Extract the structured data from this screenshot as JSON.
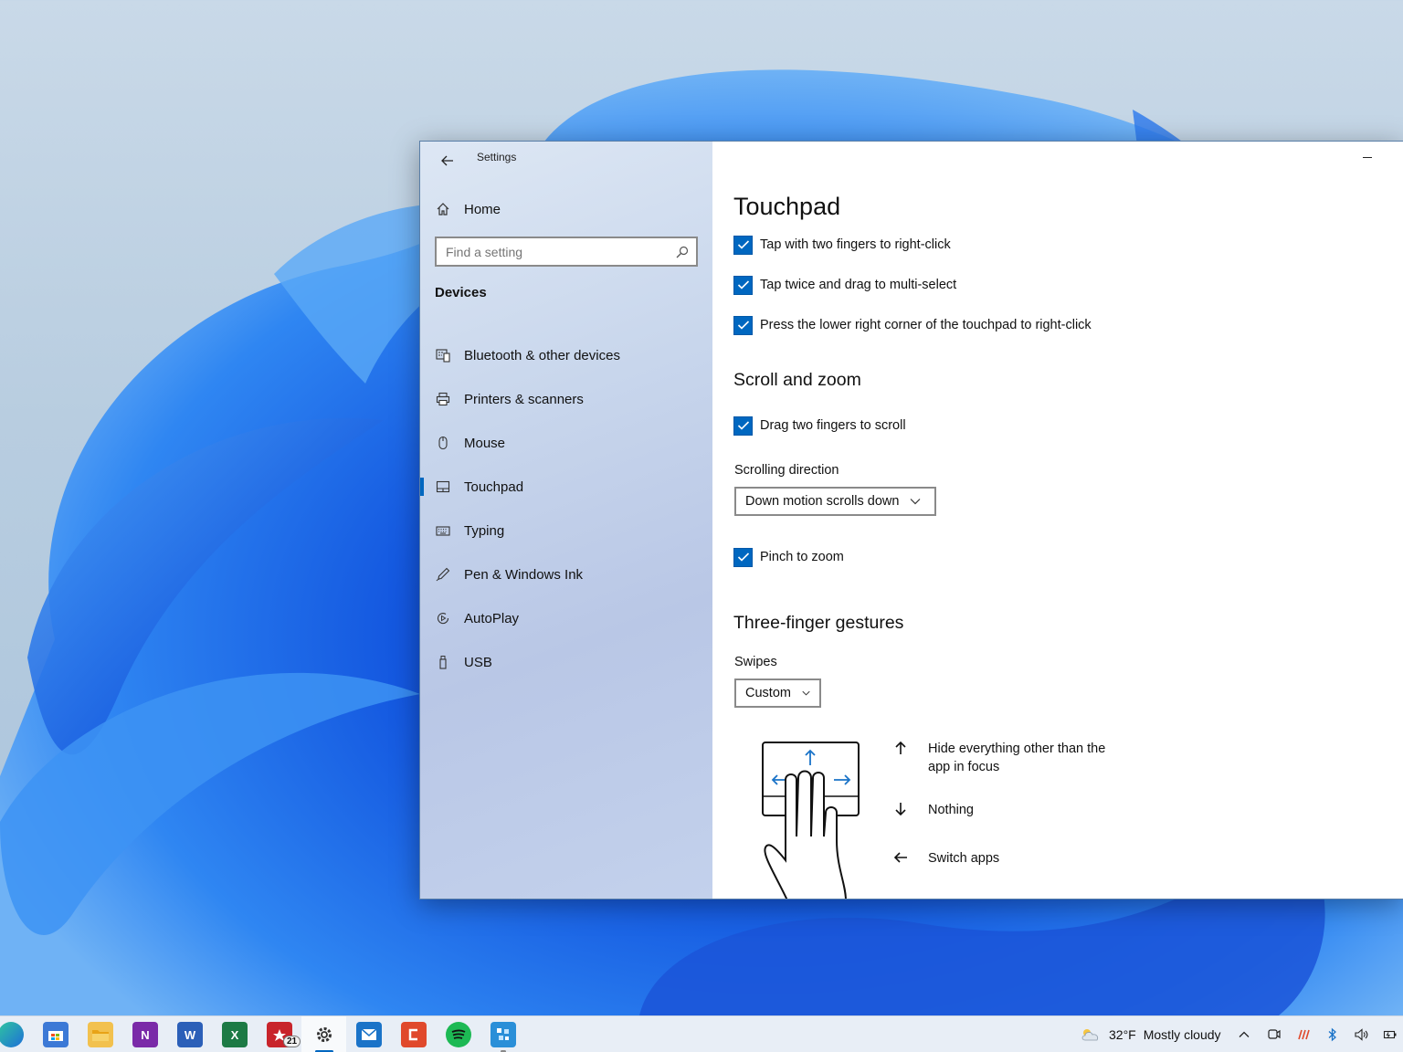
{
  "window": {
    "title": "Settings"
  },
  "nav": {
    "home_label": "Home",
    "search_placeholder": "Find a setting",
    "section_title": "Devices",
    "items": [
      {
        "label": "Bluetooth & other devices",
        "icon": "bluetooth-devices-icon",
        "active": false
      },
      {
        "label": "Printers & scanners",
        "icon": "printer-icon",
        "active": false
      },
      {
        "label": "Mouse",
        "icon": "mouse-icon",
        "active": false
      },
      {
        "label": "Touchpad",
        "icon": "touchpad-icon",
        "active": true
      },
      {
        "label": "Typing",
        "icon": "keyboard-icon",
        "active": false
      },
      {
        "label": "Pen & Windows Ink",
        "icon": "pen-icon",
        "active": false
      },
      {
        "label": "AutoPlay",
        "icon": "autoplay-icon",
        "active": false
      },
      {
        "label": "USB",
        "icon": "usb-icon",
        "active": false
      }
    ]
  },
  "content": {
    "title": "Touchpad",
    "taps": {
      "two_finger_right_click": {
        "label": "Tap with two fingers to right-click",
        "checked": true
      },
      "tap_twice_drag": {
        "label": "Tap twice and drag to multi-select",
        "checked": true
      },
      "lower_right_corner": {
        "label": "Press the lower right corner of the touchpad to right-click",
        "checked": true
      }
    },
    "scroll_zoom": {
      "heading": "Scroll and zoom",
      "drag_two_fingers": {
        "label": "Drag two fingers to scroll",
        "checked": true
      },
      "scrolling_direction_label": "Scrolling direction",
      "scrolling_direction_value": "Down motion scrolls down",
      "pinch_to_zoom": {
        "label": "Pinch to zoom",
        "checked": true
      }
    },
    "three_finger": {
      "heading": "Three-finger gestures",
      "swipes_label": "Swipes",
      "swipes_value": "Custom",
      "gestures": [
        {
          "direction": "up",
          "text": "Hide everything other than the app in focus"
        },
        {
          "direction": "down",
          "text": "Nothing"
        },
        {
          "direction": "left",
          "text": "Switch apps"
        }
      ]
    }
  },
  "taskbar": {
    "apps": [
      "edge-icon",
      "store-icon",
      "file-explorer-icon",
      "onenote-icon",
      "word-icon",
      "excel-icon",
      "acrobat-icon",
      "settings-icon",
      "mail-icon",
      "snagit-icon",
      "spotify-icon",
      "devtool-icon"
    ],
    "acrobat_badge": "21",
    "weather": {
      "temp": "32°F",
      "condition": "Mostly cloudy"
    },
    "accent": "#0067c0"
  }
}
